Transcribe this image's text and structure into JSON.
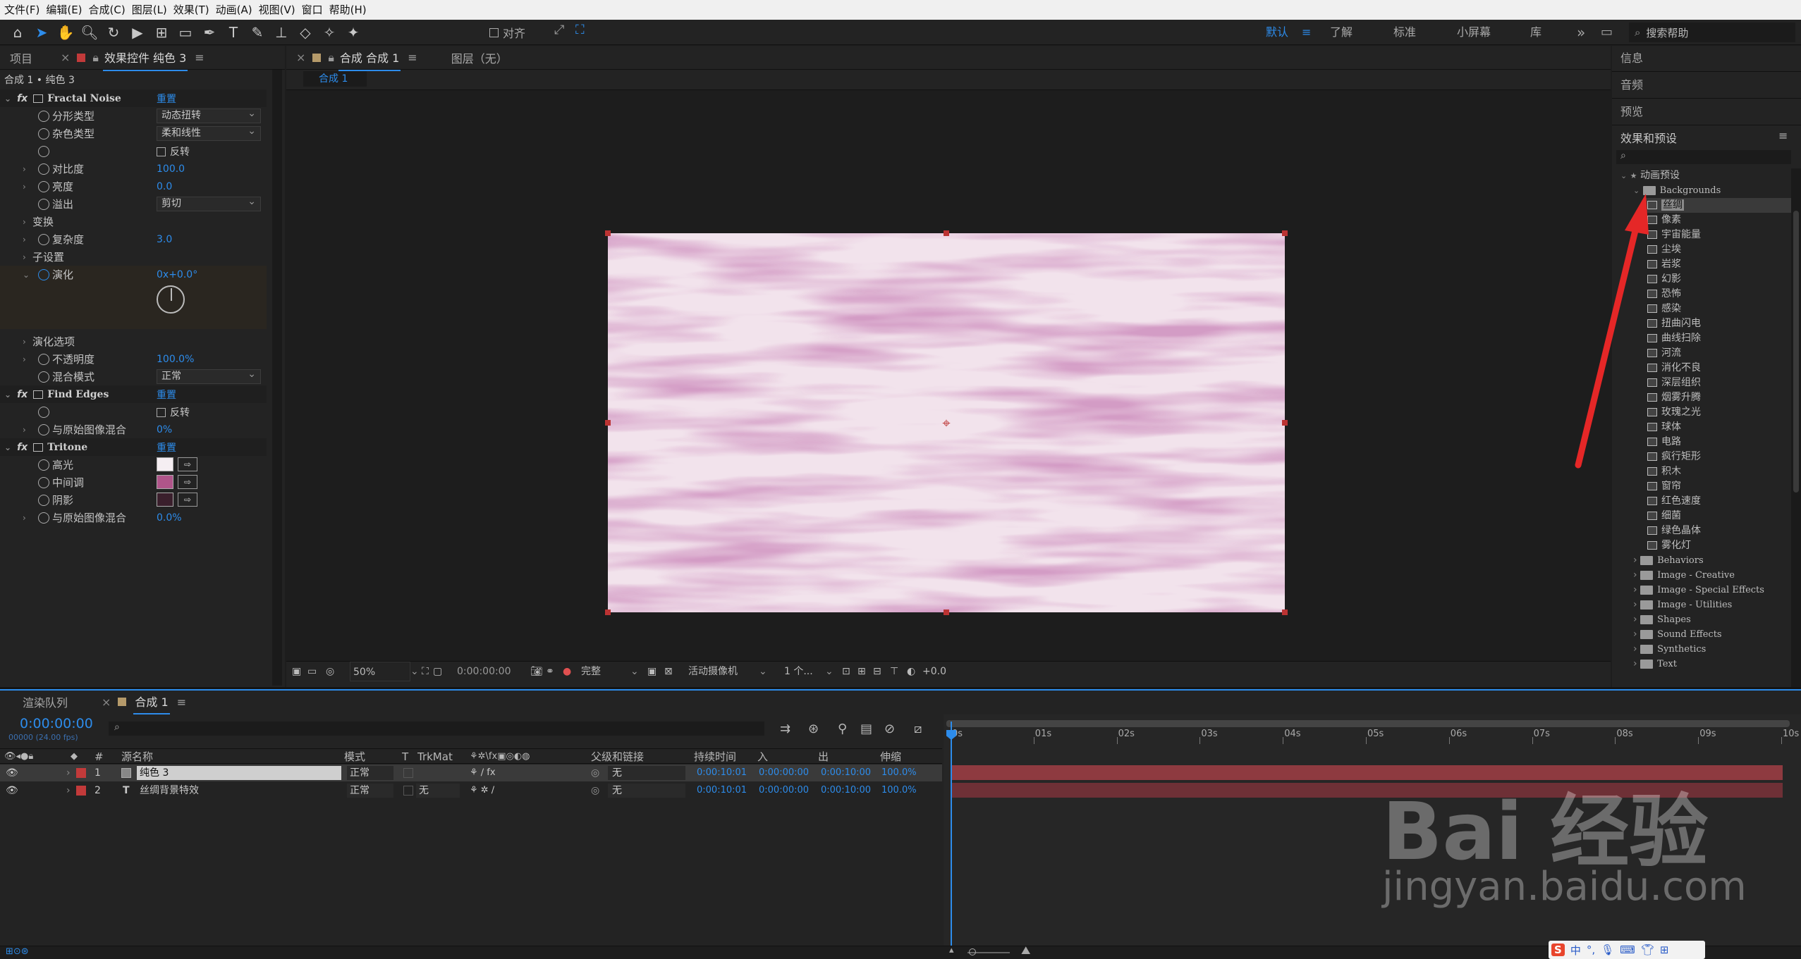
{
  "menu": [
    "文件(F)",
    "编辑(E)",
    "合成(C)",
    "图层(L)",
    "效果(T)",
    "动画(A)",
    "视图(V)",
    "窗口",
    "帮助(H)"
  ],
  "toolbar": {
    "align_label": "对齐",
    "workspaces": [
      "默认",
      "了解",
      "标准",
      "小屏幕",
      "库"
    ],
    "search_placeholder": "搜索帮助",
    "more": "»"
  },
  "left_panel": {
    "tab_project": "项目",
    "tab_effects": "效果控件 纯色 3",
    "breadcrumb": "合成 1 • 纯色 3",
    "reset": "重置",
    "effects": [
      {
        "name": "Fractal Noise",
        "props": [
          {
            "label": "分形类型",
            "dropdown": "动态扭转"
          },
          {
            "label": "杂色类型",
            "dropdown": "柔和线性"
          },
          {
            "label": "",
            "checkbox": "反转"
          },
          {
            "label": "对比度",
            "value": "100.0"
          },
          {
            "label": "亮度",
            "value": "0.0"
          },
          {
            "label": "溢出",
            "dropdown": "剪切"
          },
          {
            "label": "变换"
          },
          {
            "label": "复杂度",
            "value": "3.0"
          },
          {
            "label": "子设置"
          },
          {
            "label": "演化",
            "value": "0x+0.0°"
          },
          {
            "label": "演化选项"
          },
          {
            "label": "不透明度",
            "value": "100.0%"
          },
          {
            "label": "混合模式",
            "dropdown": "正常"
          }
        ]
      },
      {
        "name": "Find Edges",
        "props": [
          {
            "label": "",
            "checkbox": "反转"
          },
          {
            "label": "与原始图像混合",
            "value": "0%"
          }
        ]
      },
      {
        "name": "Tritone",
        "props": [
          {
            "label": "高光",
            "color": "#f5eef2"
          },
          {
            "label": "中间调",
            "color": "#b0558a"
          },
          {
            "label": "阴影",
            "color": "#3a1f2c"
          },
          {
            "label": "与原始图像混合",
            "value": "0.0%"
          }
        ]
      }
    ]
  },
  "comp": {
    "tab": "合成 合成 1",
    "layer_tab": "图层（无）",
    "sub_tab": "合成 1",
    "zoom": "50%",
    "time": "0:00:00:00",
    "quality": "完整",
    "camera": "活动摄像机",
    "views": "1 个...",
    "exposure": "+0.0"
  },
  "right_panel": {
    "tabs": [
      "信息",
      "音频",
      "预览",
      "效果和预设"
    ],
    "search_icon": "⌕",
    "root": "动画预设",
    "folder": "Backgrounds",
    "presets": [
      "丝绸",
      "像素",
      "宇宙能量",
      "尘埃",
      "岩浆",
      "幻影",
      "恐怖",
      "感染",
      "扭曲闪电",
      "曲线扫除",
      "河流",
      "消化不良",
      "深层组织",
      "烟雾升腾",
      "玫瑰之光",
      "球体",
      "电路",
      "疯行矩形",
      "积木",
      "窗帘",
      "红色速度",
      "细菌",
      "绿色晶体",
      "雾化灯"
    ],
    "folders": [
      "Behaviors",
      "Image - Creative",
      "Image - Special Effects",
      "Image - Utilities",
      "Shapes",
      "Sound Effects",
      "Synthetics",
      "Text"
    ]
  },
  "timeline": {
    "tab_render": "渲染队列",
    "tab_comp": "合成 1",
    "timecode": "0:00:00:00",
    "fps": "00000 (24.00 fps)",
    "columns": [
      "#",
      "源名称",
      "模式",
      "T",
      "TrkMat",
      "父级和链接",
      "持续时间",
      "入",
      "出",
      "伸缩"
    ],
    "ticks": [
      "0s",
      "01s",
      "02s",
      "03s",
      "04s",
      "05s",
      "06s",
      "07s",
      "08s",
      "09s",
      "10s"
    ],
    "layers": [
      {
        "num": "1",
        "name": "纯色 3",
        "mode": "正常",
        "trkmat": "",
        "parent": "无",
        "duration": "0:00:10:01",
        "in": "0:00:00:00",
        "out": "0:00:10:00",
        "stretch": "100.0%",
        "type": "solid"
      },
      {
        "num": "2",
        "name": "丝绸背景特效",
        "mode": "正常",
        "trkmat": "无",
        "parent": "无",
        "duration": "0:00:10:01",
        "in": "0:00:00:00",
        "out": "0:00:10:00",
        "stretch": "100.0%",
        "type": "text"
      }
    ]
  },
  "watermark": {
    "brand": "Bai 经验",
    "url": "jingyan.baidu.com"
  },
  "ime": {
    "label": "中"
  }
}
